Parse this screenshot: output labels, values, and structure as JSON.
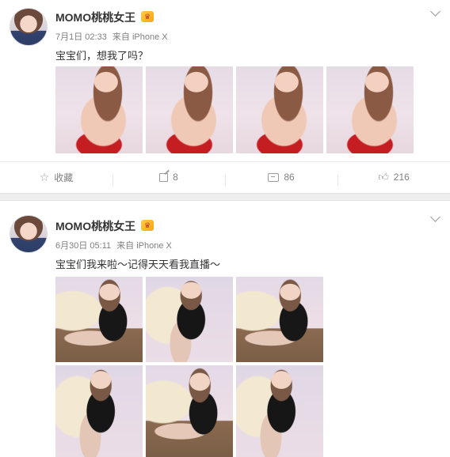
{
  "posts": [
    {
      "username": "MOMO桃桃女王",
      "vip_icon": "crown-badge-icon",
      "date": "7月1日 02:33",
      "source": "来自 iPhone X",
      "text": "宝宝们，想我了吗？",
      "photo_count": 4,
      "actions": {
        "favorite_label": "收藏",
        "repost_count": "8",
        "comment_count": "86",
        "like_count": "216"
      }
    },
    {
      "username": "MOMO桃桃女王",
      "vip_icon": "crown-badge-icon",
      "date": "6月30日 05:11",
      "source": "来自 iPhone X",
      "text": "宝宝们我来啦～记得天天看我直播～",
      "photo_count": 6
    }
  ],
  "colors": {
    "background": "#f2f2f2",
    "card": "#ffffff",
    "meta_text": "#808080",
    "body_text": "#333333"
  }
}
